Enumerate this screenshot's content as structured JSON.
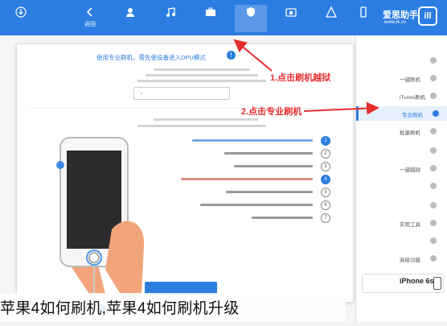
{
  "colors": {
    "brand_blue": "#2b7de1",
    "annotation_red": "#e52e2e",
    "sidebar_active_bg": "#e6f0fc"
  },
  "toolbar": {
    "items": [
      {
        "label": "返回",
        "icon": "back-arrow-icon"
      },
      {
        "label": "",
        "icon": "user-icon"
      },
      {
        "label": "",
        "icon": "music-icon"
      },
      {
        "label": "",
        "icon": "toolbox-icon"
      },
      {
        "label": "",
        "icon": "flash-icon"
      },
      {
        "label": "",
        "icon": "store-icon"
      },
      {
        "label": "",
        "icon": "apps-icon"
      },
      {
        "label": "",
        "icon": "device-icon"
      }
    ]
  },
  "logo": {
    "mark": "ill",
    "name": "爱思助手",
    "url": "www.i4.cn"
  },
  "sidebar": {
    "items": [
      {
        "label": ""
      },
      {
        "label": "一键刷机"
      },
      {
        "label": "iTunes刷机"
      },
      {
        "label": "专业刷机"
      },
      {
        "label": "批量刷机"
      },
      {
        "label": ""
      },
      {
        "label": "一键越狱"
      },
      {
        "label": ""
      },
      {
        "label": ""
      },
      {
        "label": "实用工具"
      },
      {
        "label": ""
      },
      {
        "label": "高级功能"
      }
    ],
    "active_index": 3
  },
  "device": {
    "name": "iPhone 6s",
    "version": ""
  },
  "dialog": {
    "notice": "使用专业刷机，需先使设备进入DPU模式"
  },
  "annotations": {
    "step1": "1.点击刷机越狱",
    "step2": "2.点击专业刷机"
  },
  "caption": "苹果4如何刷机,苹果4如何刷机升级"
}
